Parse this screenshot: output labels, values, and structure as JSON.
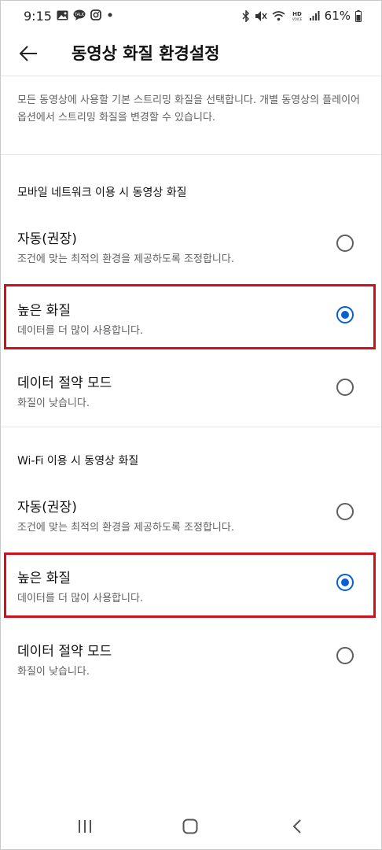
{
  "status_bar": {
    "time": "9:15",
    "battery": "61%",
    "left_icons": [
      "gallery-icon",
      "talk-icon",
      "instagram-icon",
      "dot-icon"
    ],
    "right_icons": [
      "bluetooth-icon",
      "mute-icon",
      "wifi-icon",
      "hd-voice-icon",
      "signal-icon",
      "battery-icon"
    ]
  },
  "header": {
    "title": "동영상 화질 환경설정"
  },
  "description": "모든 동영상에 사용할 기본 스트리밍 화질을 선택합니다. 개별 동영상의 플레이어 옵션에서 스트리밍 화질을 변경할 수 있습니다.",
  "sections": [
    {
      "title": "모바일 네트워크 이용 시 동영상 화질",
      "options": [
        {
          "label": "자동(권장)",
          "sub": "조건에 맞는 최적의 환경을 제공하도록 조정합니다.",
          "selected": false
        },
        {
          "label": "높은 화질",
          "sub": "데이터를 더 많이 사용합니다.",
          "selected": true
        },
        {
          "label": "데이터 절약 모드",
          "sub": "화질이 낮습니다.",
          "selected": false
        }
      ]
    },
    {
      "title": "Wi-Fi 이용 시 동영상 화질",
      "options": [
        {
          "label": "자동(권장)",
          "sub": "조건에 맞는 최적의 환경을 제공하도록 조정합니다.",
          "selected": false
        },
        {
          "label": "높은 화질",
          "sub": "데이터를 더 많이 사용합니다.",
          "selected": true
        },
        {
          "label": "데이터 절약 모드",
          "sub": "화질이 낮습니다.",
          "selected": false
        }
      ]
    }
  ],
  "colors": {
    "accent": "#065fd4",
    "highlight": "#d0111c"
  }
}
